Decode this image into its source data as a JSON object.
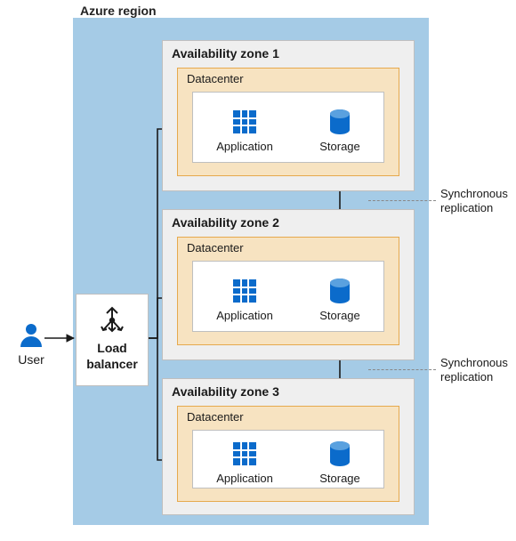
{
  "user": {
    "label": "User",
    "icon": "user-icon"
  },
  "region": {
    "label": "Azure region"
  },
  "loadBalancer": {
    "label1": "Load",
    "label2": "balancer",
    "icon": "load-balancer-icon"
  },
  "zones": [
    {
      "title": "Availability zone 1",
      "datacenter": "Datacenter",
      "app": "Application",
      "storage": "Storage"
    },
    {
      "title": "Availability zone 2",
      "datacenter": "Datacenter",
      "app": "Application",
      "storage": "Storage"
    },
    {
      "title": "Availability zone 3",
      "datacenter": "Datacenter",
      "app": "Application",
      "storage": "Storage"
    }
  ],
  "annotations": {
    "replication1a": "Synchronous",
    "replication1b": "replication",
    "replication2a": "Synchronous",
    "replication2b": "replication"
  }
}
